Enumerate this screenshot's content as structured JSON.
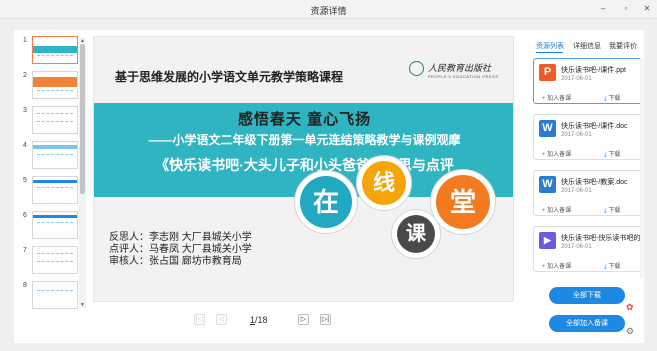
{
  "window": {
    "title": "资源详情",
    "minimize": "–",
    "maximize": "▫",
    "close": "✕"
  },
  "thumbnails": [
    {
      "num": "1",
      "active": true
    },
    {
      "num": "2",
      "active": false
    },
    {
      "num": "3",
      "active": false
    },
    {
      "num": "4",
      "active": false
    },
    {
      "num": "5",
      "active": false
    },
    {
      "num": "6",
      "active": false
    },
    {
      "num": "7",
      "active": false
    },
    {
      "num": "8",
      "active": false
    }
  ],
  "slide": {
    "course_title": "基于思维发展的小学语文单元教学策略课程",
    "publisher_cn": "人民教育出版社",
    "publisher_en": "PEOPLE'S EDUCATION PRESS",
    "line1": "感悟春天    童心飞扬",
    "line2": "——小学语文二年级下册第一单元连结策略教学与课例观摩",
    "line3": "《快乐读书吧·大头儿子和小头爸爸》反思与点评",
    "people": [
      "反思人：李志刚  大厂县城关小学",
      "点评人：马春凤  大厂县城关小学",
      "审核人：张占国  廊坊市教育局"
    ],
    "bubbles": {
      "zai": "在",
      "xian": "线",
      "ke": "课",
      "tang": "堂"
    }
  },
  "pager": {
    "first": "|◁",
    "prev": "◁",
    "current": "1",
    "total": "/18",
    "next": "▷",
    "last": "▷|"
  },
  "tabs": [
    "资源列表",
    "详细信息",
    "我要评价"
  ],
  "resources": [
    {
      "icon": "P",
      "color": "#f05a28",
      "name": "快乐读书吧-/课件.ppt",
      "date": "2017-06-01",
      "add": "加入备课",
      "download": "下载",
      "selected": true
    },
    {
      "icon": "W",
      "color": "#2b7cd3",
      "name": "快乐读书吧-/课件.doc",
      "date": "2017-06-01",
      "add": "加入备课",
      "download": "下载",
      "selected": false
    },
    {
      "icon": "W",
      "color": "#2b7cd3",
      "name": "快乐读书吧-/教案.doc",
      "date": "2017-06-01",
      "add": "加入备课",
      "download": "下载",
      "selected": false
    },
    {
      "icon": "▶",
      "color": "#6a5bd8",
      "name": "快乐读书吧-快乐读书吧的…",
      "date": "2017-06-01",
      "add": "加入备课",
      "download": "下载",
      "selected": false
    }
  ],
  "actions": {
    "download_all": "全部下载",
    "add_all": "全部加入备课"
  },
  "colors": {
    "accent": "#1e88e5",
    "banner": "#2fb4c1"
  }
}
